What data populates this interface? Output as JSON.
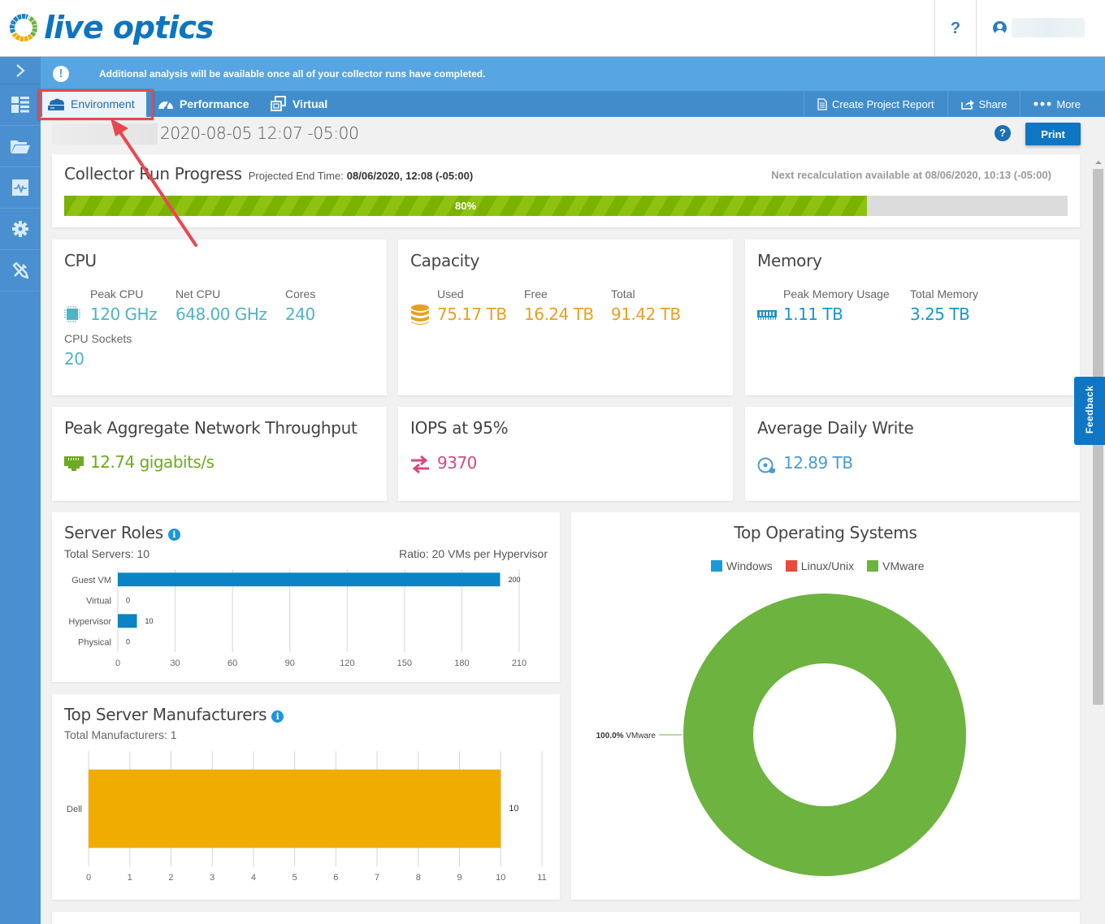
{
  "header": {
    "brand": "live optics",
    "help_label": "?"
  },
  "sidebar": {
    "items": [
      {
        "icon": "chevron-right-icon"
      },
      {
        "icon": "dashboard-icon"
      },
      {
        "icon": "folder-open-icon"
      },
      {
        "icon": "monitor-pulse-icon"
      },
      {
        "icon": "gear-icon"
      },
      {
        "icon": "tools-icon"
      }
    ]
  },
  "alert": {
    "icon": "!",
    "text": "Additional analysis will be available once all of your collector runs have completed."
  },
  "nav": {
    "tabs": [
      {
        "label": "Environment",
        "icon": "cloud-server-icon",
        "active": true
      },
      {
        "label": "Performance",
        "icon": "speedometer-icon",
        "active": false
      },
      {
        "label": "Virtual",
        "icon": "virtual-windows-icon",
        "active": false
      }
    ],
    "actions": {
      "report": "Create Project Report",
      "share": "Share",
      "more": "More"
    }
  },
  "subheader": {
    "date": "2020-08-05 12:07 -05:00",
    "help_label": "?",
    "print_label": "Print"
  },
  "progress": {
    "title": "Collector Run Progress",
    "projected_label": "Projected End Time:",
    "projected_value": "08/06/2020, 12:08 (-05:00)",
    "recalc": "Next recalculation available at 08/06/2020, 10:13 (-05:00)",
    "percent_label": "80%",
    "percent": 80
  },
  "cpu": {
    "title": "CPU",
    "peak_label": "Peak CPU",
    "peak_value": "120 GHz",
    "net_label": "Net CPU",
    "net_value": "648.00 GHz",
    "cores_label": "Cores",
    "cores_value": "240",
    "sockets_label": "CPU Sockets",
    "sockets_value": "20"
  },
  "capacity": {
    "title": "Capacity",
    "used_label": "Used",
    "used_value": "75.17 TB",
    "free_label": "Free",
    "free_value": "16.24 TB",
    "total_label": "Total",
    "total_value": "91.42 TB"
  },
  "memory": {
    "title": "Memory",
    "peak_label": "Peak Memory Usage",
    "peak_value": "1.11 TB",
    "total_label": "Total Memory",
    "total_value": "3.25 TB"
  },
  "network": {
    "title": "Peak Aggregate Network Throughput",
    "value": "12.74 gigabits/s"
  },
  "iops": {
    "title": "IOPS at 95%",
    "value": "9370"
  },
  "daily_write": {
    "title": "Average Daily Write",
    "value": "12.89 TB"
  },
  "server_roles": {
    "title": "Server Roles",
    "total": "Total Servers: 10",
    "ratio": "Ratio: 20 VMs per Hypervisor"
  },
  "manufacturers": {
    "title": "Top Server Manufacturers",
    "total": "Total Manufacturers: 1"
  },
  "os": {
    "title": "Top Operating Systems",
    "legend": [
      {
        "label": "Windows",
        "color": "#1a9ad9"
      },
      {
        "label": "Linux/Unix",
        "color": "#e84c3d"
      },
      {
        "label": "VMware",
        "color": "#6db33f"
      }
    ],
    "slice_label_pct": "100.0%",
    "slice_label_name": "VMware"
  },
  "feedback_label": "Feedback",
  "chart_data": [
    {
      "type": "bar",
      "orientation": "horizontal",
      "title": "Server Roles",
      "categories": [
        "Guest VM",
        "Virtual",
        "Hypervisor",
        "Physical"
      ],
      "values": [
        200,
        0,
        10,
        0
      ],
      "xlim": [
        0,
        210
      ],
      "xticks": [
        0,
        30,
        60,
        90,
        120,
        150,
        180,
        210
      ],
      "color": "#0a84c4",
      "grid": true
    },
    {
      "type": "bar",
      "orientation": "horizontal",
      "title": "Top Server Manufacturers",
      "categories": [
        "Dell"
      ],
      "values": [
        10
      ],
      "xlim": [
        0,
        11
      ],
      "xticks": [
        0,
        1,
        2,
        3,
        4,
        5,
        6,
        7,
        8,
        9,
        10,
        11
      ],
      "color": "#f0ad00",
      "grid": true
    },
    {
      "type": "pie",
      "donut": true,
      "title": "Top Operating Systems",
      "labels": [
        "Windows",
        "Linux/Unix",
        "VMware"
      ],
      "values": [
        0,
        0,
        100
      ],
      "colors": [
        "#1a9ad9",
        "#e84c3d",
        "#6db33f"
      ],
      "legend": "top"
    }
  ]
}
